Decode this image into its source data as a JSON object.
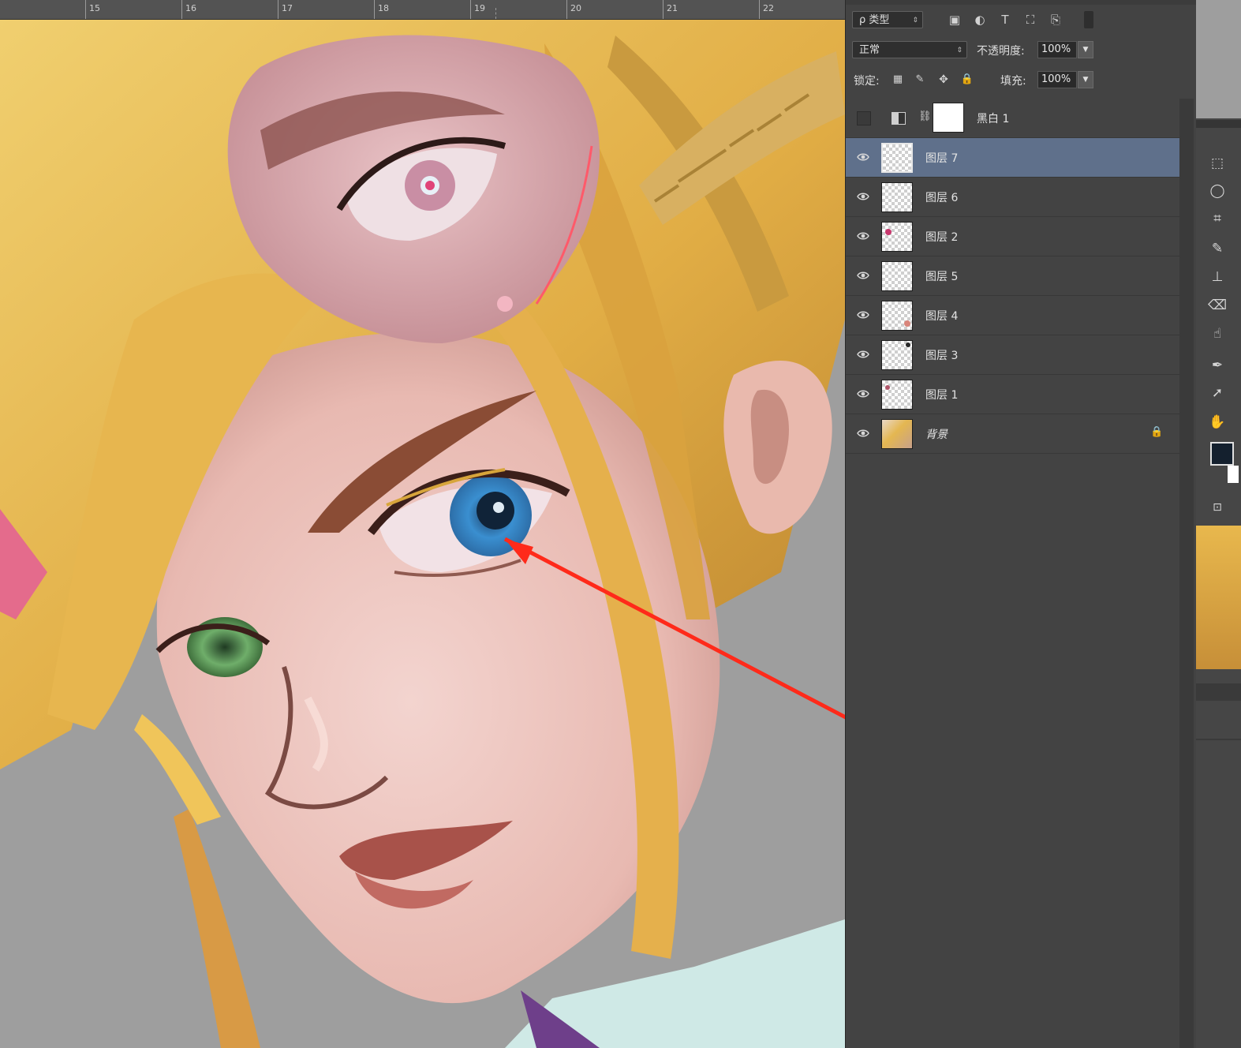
{
  "ruler": {
    "marks": [
      "15",
      "16",
      "17",
      "18",
      "19",
      "20",
      "21",
      "22"
    ]
  },
  "layers_panel": {
    "filter_kind": "ρ 类型",
    "blend_mode": "正常",
    "opacity_label": "不透明度:",
    "opacity_value": "100%",
    "lock_label": "锁定:",
    "fill_label": "填充:",
    "fill_value": "100%",
    "adjustment_layer": {
      "name": "黑白 1",
      "visible": false
    },
    "layers": [
      {
        "name": "图层 7",
        "selected": true
      },
      {
        "name": "图层 6",
        "selected": false
      },
      {
        "name": "图层 2",
        "selected": false
      },
      {
        "name": "图层 5",
        "selected": false
      },
      {
        "name": "图层 4",
        "selected": false
      },
      {
        "name": "图层 3",
        "selected": false
      },
      {
        "name": "图层 1",
        "selected": false
      },
      {
        "name": "背景",
        "selected": false,
        "locked": true
      }
    ]
  },
  "toolbox": {
    "tools": [
      "rect-marquee-icon",
      "lasso-icon",
      "crop-icon",
      "brush-icon",
      "stamp-icon",
      "eraser-icon",
      "smudge-icon",
      "pen-icon",
      "path-select-icon",
      "hand-icon"
    ],
    "foreground_color": "#14202e",
    "background_color": "#ffffff"
  },
  "annotation": {
    "arrow_color": "#ff2a1a"
  }
}
